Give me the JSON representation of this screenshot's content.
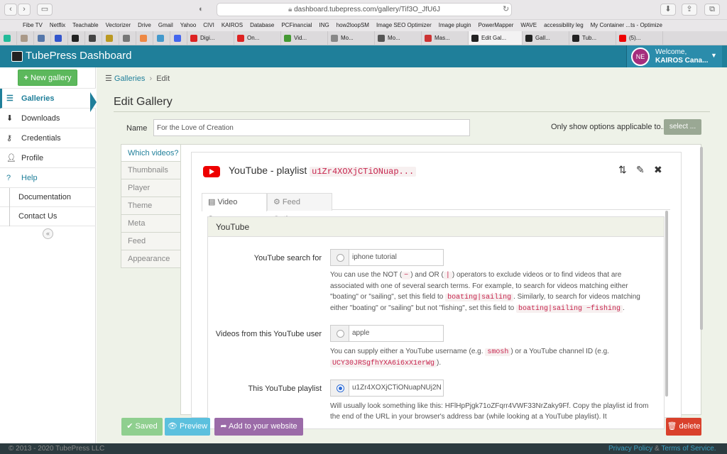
{
  "browser": {
    "url": "dashboard.tubepress.com/gallery/Tif3O_JfU6J",
    "bookmarks": [
      "Fibe TV",
      "Netflix",
      "Teachable",
      "Vectorizer",
      "Drive",
      "Gmail",
      "Yahoo",
      "CIVI",
      "KAIROS",
      "Database",
      "PCFinancial",
      "ING",
      "how2loopSM",
      "Image SEO Optimizer",
      "Image plugin",
      "PowerMapper",
      "WAVE",
      "accessibility leg",
      "My Container ...ts - Optimize"
    ],
    "tabs": [
      "Digi...",
      "On...",
      "Vid...",
      "Mo...",
      "Mo...",
      "Mas...",
      "Edit Gal...",
      "Gall...",
      "Tub...",
      "(5)..."
    ]
  },
  "header": {
    "title": "TubePress Dashboard",
    "avatar_initials": "NE",
    "welcome": "Welcome,",
    "account": "KAIROS Cana..."
  },
  "sidebar": {
    "new_gallery": "New gallery",
    "items": [
      "Galleries",
      "Downloads",
      "Credentials",
      "Profile",
      "Help"
    ],
    "subitems": [
      "Documentation",
      "Contact Us"
    ]
  },
  "breadcrumb": {
    "root": "Galleries",
    "current": "Edit"
  },
  "page": {
    "title": "Edit Gallery",
    "name_label": "Name",
    "name_value": "For the Love of Creation",
    "only_show": "Only show options applicable to...",
    "select_btn": "select ..."
  },
  "vtabs": [
    "Which videos?",
    "Thumbnails",
    "Player",
    "Theme",
    "Meta",
    "Feed",
    "Appearance"
  ],
  "feed": {
    "title": "YouTube - playlist",
    "id": "u1Zr4XOXjCTiONuap..."
  },
  "source_tabs": [
    "Video Source",
    "Feed Options"
  ],
  "section": {
    "heading": "YouTube",
    "search_label": "YouTube search for",
    "search_value": "iphone tutorial",
    "search_help_1": "You can use the NOT (",
    "not_op": "−",
    "search_help_2": ") and OR (",
    "or_op": "|",
    "search_help_3": ") operators to exclude videos or to find videos that are associated with one of several search terms. For example, to search for videos matching either \"boating\" or \"sailing\", set this field to",
    "code_a": "boating|sailing",
    "search_help_4": ". Similarly, to search for videos matching either \"boating\" or \"sailing\" but not \"fishing\", set this field to",
    "code_b": "boating|sailing −fishing",
    "search_help_5": ".",
    "user_label": "Videos from this YouTube user",
    "user_value": "apple",
    "user_help_1": "You can supply either a YouTube username (e.g.",
    "code_c": "smosh",
    "user_help_2": ") or a YouTube channel ID (e.g.",
    "code_d": "UCY30JRSgfhYXA6i6xX1erWg",
    "user_help_3": ").",
    "playlist_label": "This YouTube playlist",
    "playlist_value": "u1Zr4XOXjCTiONuapNUj2N",
    "playlist_help": "Will usually look something like this: HFlHpPjgk71oZFqrr4VWF33NrZaky9Ff. Copy the playlist id from the end of the URL in your browser's address bar (while looking at a YouTube playlist). It"
  },
  "buttons": {
    "saved": "Saved",
    "preview": "Preview",
    "add": "Add to your website",
    "delete": "delete"
  },
  "footer": {
    "copy": "© 2013 - 2020 TubePress LLC",
    "privacy": "Privacy Policy",
    "amp": "&",
    "terms": "Terms of Service."
  }
}
